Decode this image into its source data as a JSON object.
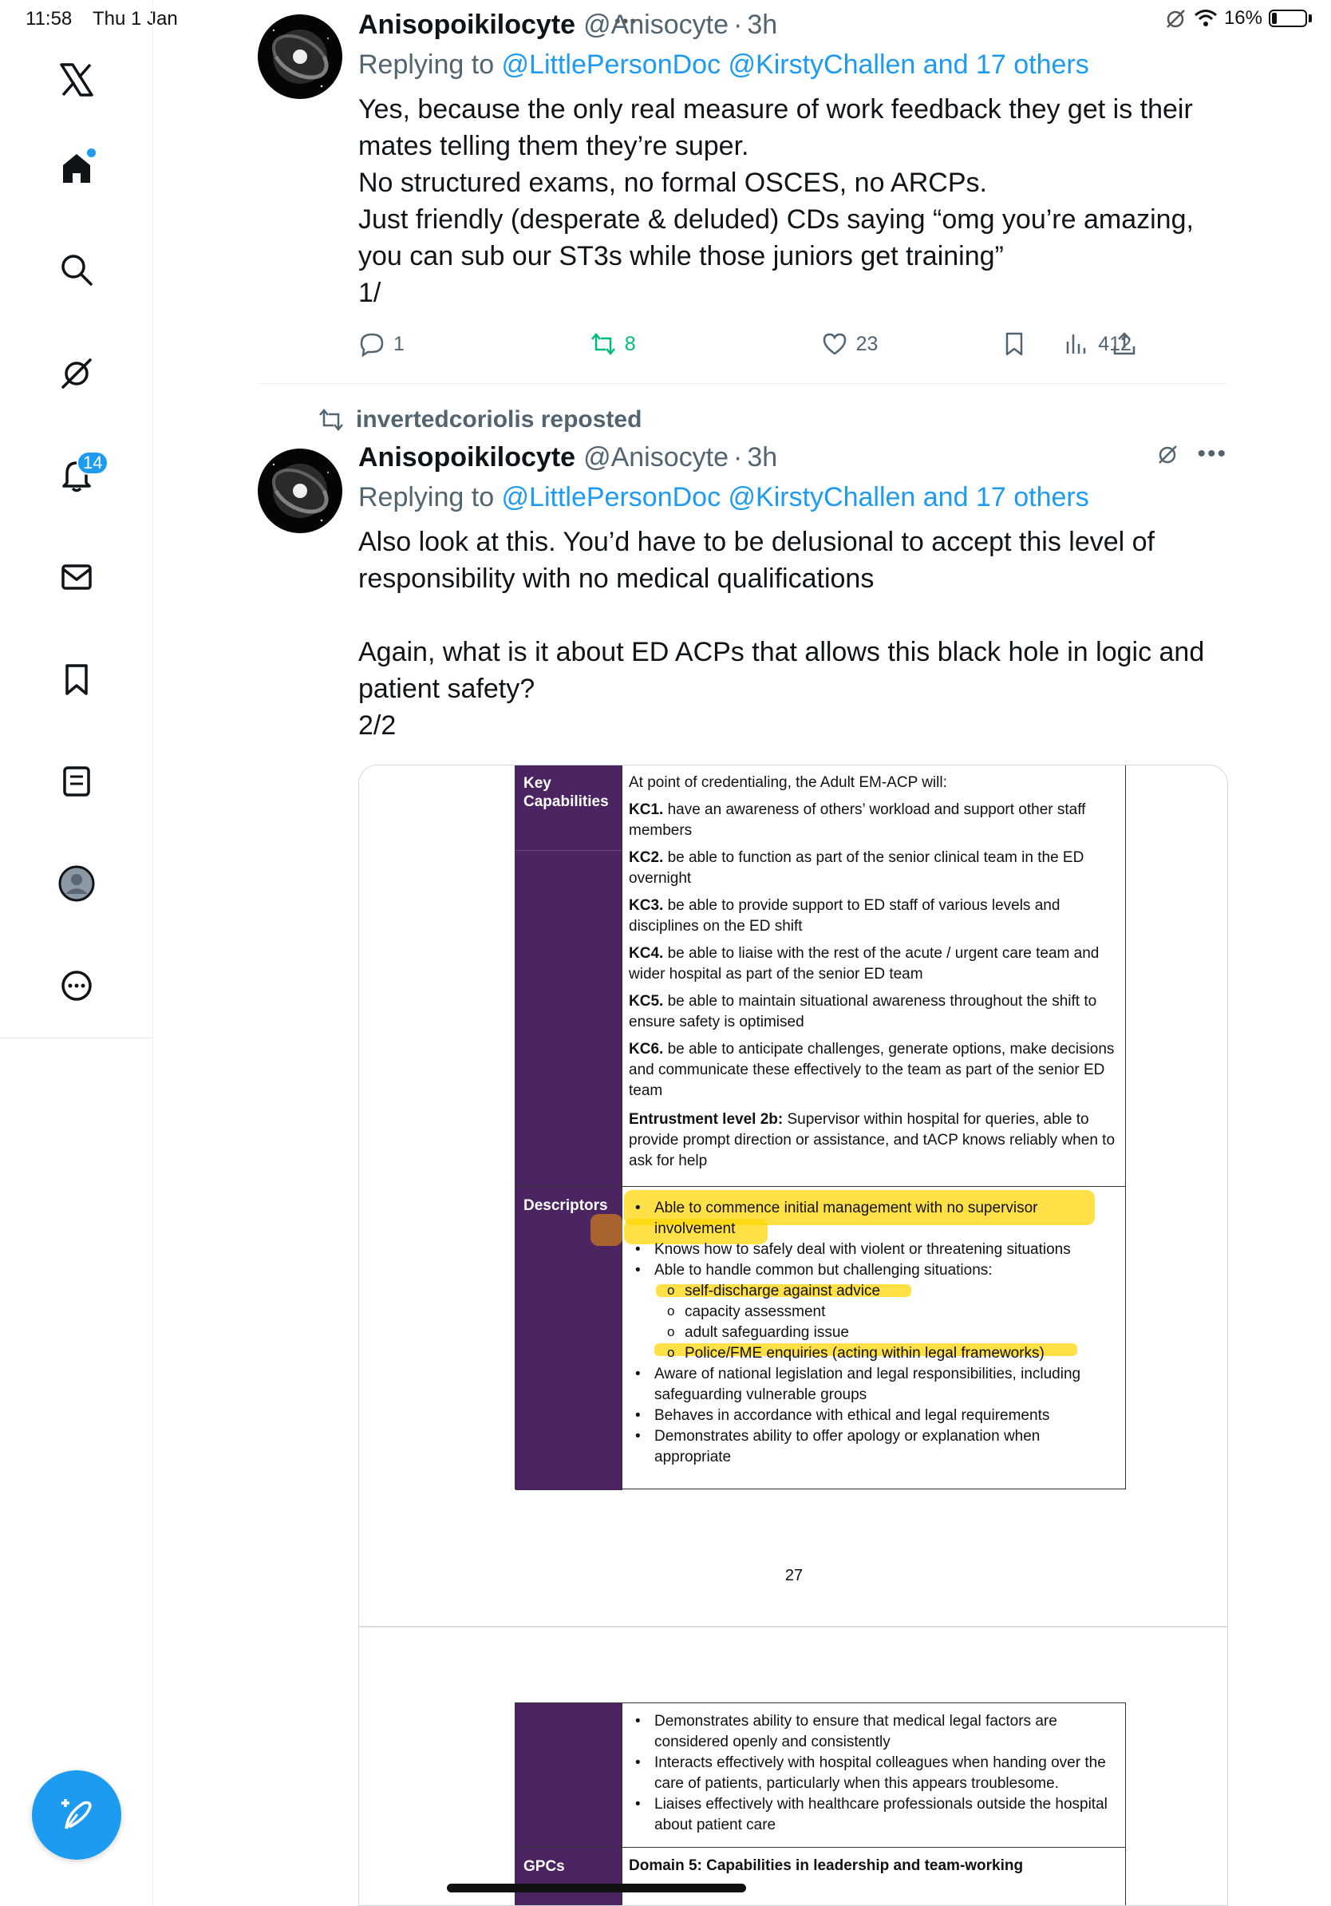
{
  "status_bar": {
    "time": "11:58",
    "date": "Thu 1 Jan",
    "battery": "16%",
    "battery_level": 0.16
  },
  "sidebar": {
    "logo": "x-logo-icon",
    "items": [
      {
        "icon": "home-icon",
        "label": "Home"
      },
      {
        "icon": "search-icon",
        "label": "Explore"
      },
      {
        "icon": "grok-icon",
        "label": "Grok"
      },
      {
        "icon": "bell-icon",
        "label": "Notifications"
      },
      {
        "icon": "mail-icon",
        "label": "Messages"
      },
      {
        "icon": "bookmark-icon",
        "label": "Bookmarks"
      },
      {
        "icon": "list-icon",
        "label": "Lists"
      },
      {
        "icon": "profile-icon",
        "label": "Profile"
      },
      {
        "icon": "more-icon",
        "label": "More"
      }
    ],
    "notifications_badge": "14",
    "compose_icon": "compose-icon"
  },
  "colors": {
    "accent": "#1d9bf0",
    "doc_purple": "#4b2561",
    "highlight": "#ffd600"
  },
  "posts": [
    {
      "author": "Anisopoikilocyte",
      "handle": "@Anisocyte",
      "separator": "·",
      "time": "3h",
      "reply_prefix": "Replying to ",
      "reply_mentions": "@LittlePersonDoc @KirstyChallen and 17 others",
      "text": "Yes, because the only real measure of work feedback they get is their mates telling them they’re super.\nNo structured exams, no formal OSCES, no ARCPs.\nJust friendly (desperate & deluded) CDs saying “omg you’re amazing, you can sub our ST3s while those juniors get training”\n1/",
      "replies": "1",
      "reposts": "8",
      "likes": "23",
      "views": "412"
    },
    {
      "repost_label": "invertedcoriolis reposted",
      "author": "Anisopoikilocyte",
      "handle": "@Anisocyte",
      "separator": "·",
      "time": "3h",
      "reply_prefix": "Replying to ",
      "reply_mentions": "@LittlePersonDoc @KirstyChallen and 17 others",
      "text": "Also look at this. You’d have to be delusional to accept this level of responsibility with no medical qualifications\n\nAgain, what is it about ED ACPs that allows this black hole in logic and patient safety?\n2/2"
    }
  ],
  "document": {
    "page1": {
      "key_capabilities_label": "Key Capabilities",
      "intro": "At point of credentialing, the Adult EM-ACP will:",
      "kcs": [
        {
          "code": "KC1.",
          "text": " have an awareness of others’ workload and support other staff members"
        },
        {
          "code": "KC2.",
          "text": " be able to function as part of the senior clinical team in the ED overnight"
        },
        {
          "code": "KC3.",
          "text": " be able to provide support to ED staff of various levels and disciplines on the ED shift"
        },
        {
          "code": "KC4.",
          "text": " be able to liaise with the rest of the acute / urgent care team and wider hospital as part of the senior ED team"
        },
        {
          "code": "KC5.",
          "text": " be able to maintain situational awareness throughout the shift to ensure safety is optimised"
        },
        {
          "code": "KC6.",
          "text": " be able to anticipate challenges, generate options, make decisions and communicate these effectively to the team as part of the senior ED team"
        }
      ],
      "entrustment_label": "Entrustment level 2b:",
      "entrustment_text": " Supervisor within hospital for queries, able to provide prompt direction or assistance, and tACP knows reliably when to ask for help",
      "descriptors_label": "Descriptors",
      "descriptors": [
        "Able to commence initial management with no supervisor involvement",
        "Knows how to safely deal with violent or threatening situations",
        "Able to handle common but challenging situations:"
      ],
      "sub_items": [
        "self-discharge against advice",
        "capacity assessment",
        "adult safeguarding issue",
        "Police/FME enquiries (acting within legal frameworks)"
      ],
      "descriptors_more": [
        "Aware of national legislation and legal responsibilities, including safeguarding vulnerable groups",
        "Behaves in accordance with ethical and legal requirements",
        "Demonstrates ability to offer apology or explanation when appropriate"
      ],
      "page_number": "27"
    },
    "page2": {
      "bullets": [
        "Demonstrates ability to ensure that medical legal factors are considered openly and consistently",
        "Interacts effectively with hospital colleagues when handing over the care of patients, particularly when this appears troublesome.",
        "Liaises effectively with healthcare professionals outside the hospital about patient care"
      ],
      "gpcs_label": "GPCs",
      "domain_label": "Domain 5: Capabilities in leadership and team-working"
    }
  }
}
